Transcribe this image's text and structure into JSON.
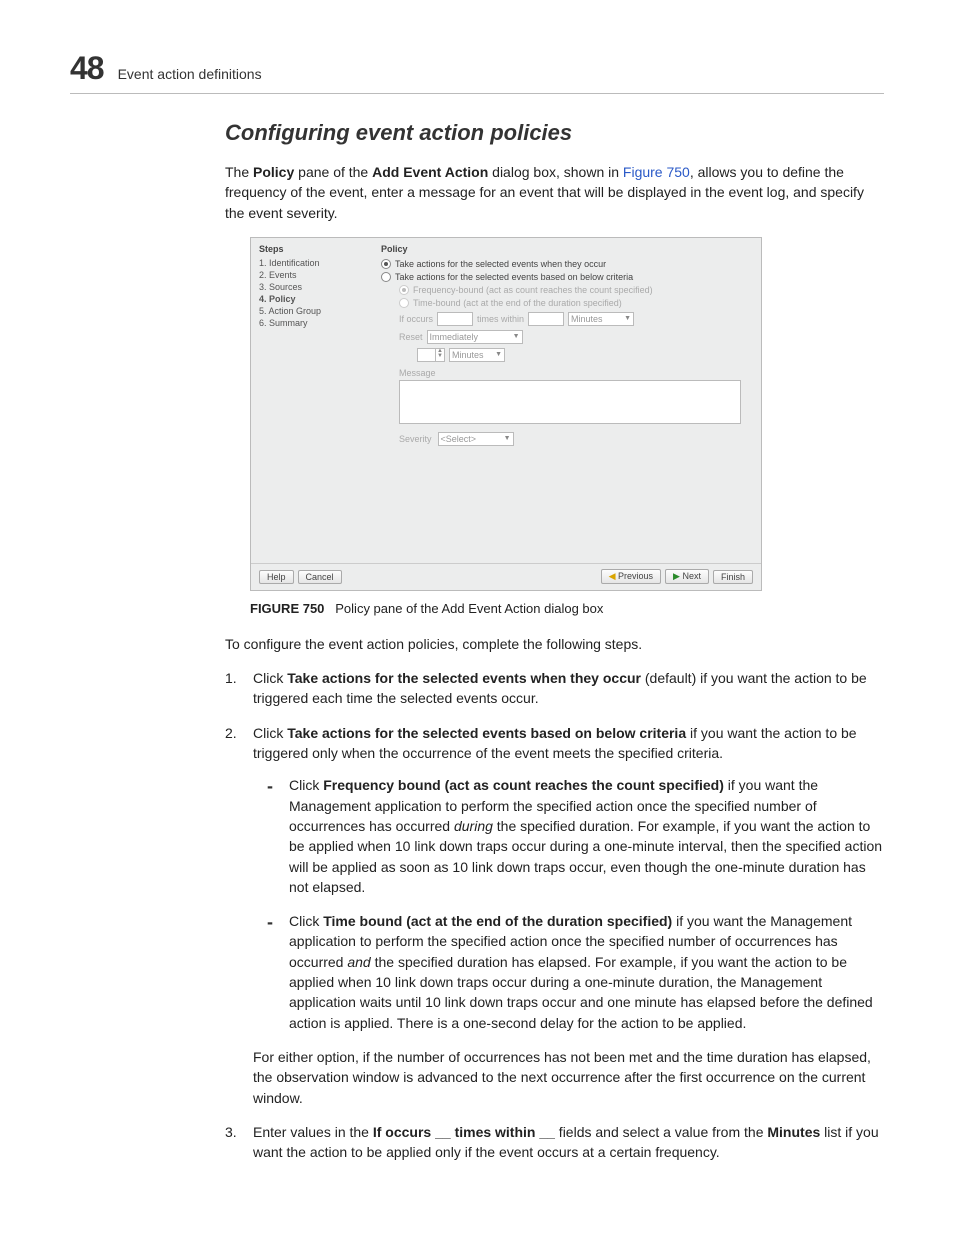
{
  "page_number": "48",
  "page_header": "Event action definitions",
  "section_heading": "Configuring event action policies",
  "intro": {
    "pre": "The ",
    "b1": "Policy",
    "mid1": " pane of the ",
    "b2": "Add Event Action",
    "mid2": " dialog box, shown in ",
    "link": "Figure 750",
    "post": ", allows you to define the frequency of the event, enter a message for an event that will be displayed in the event log, and specify the event severity."
  },
  "shot": {
    "steps_title": "Steps",
    "steps": [
      "1. Identification",
      "2. Events",
      "3. Sources",
      "4. Policy",
      "5. Action Group",
      "6. Summary"
    ],
    "policy_title": "Policy",
    "opt1": "Take actions for the selected events when they occur",
    "opt2": "Take actions for the selected events based on below criteria",
    "sub1": "Frequency-bound (act as count reaches the count specified)",
    "sub2": "Time-bound (act at the end of the duration specified)",
    "if_occurs": "If occurs",
    "times_within": "times within",
    "minutes": "Minutes",
    "reset": "Reset",
    "immediately": "Immediately",
    "message": "Message",
    "severity": "Severity",
    "select_ph": "<Select>",
    "btn_help": "Help",
    "btn_cancel": "Cancel",
    "btn_prev": "Previous",
    "btn_next": "Next",
    "btn_finish": "Finish"
  },
  "figure": {
    "label": "FIGURE 750",
    "caption": "Policy pane of the Add Event Action dialog box"
  },
  "lead_in": "To configure the event action policies, complete the following steps.",
  "step1": {
    "pre": "Click ",
    "b": "Take actions for the selected events when they occur",
    "post": " (default) if you want the action to be triggered each time the selected events occur."
  },
  "step2": {
    "pre": "Click ",
    "b": "Take actions for the selected events based on below criteria",
    "post": " if you want the action to be triggered only when the occurrence of the event meets the specified criteria.",
    "sub1": {
      "pre": "Click ",
      "b": "Frequency bound (act as count reaches the count specified)",
      "mid1": " if you want the Management application to perform the specified action once the specified number of occurrences has occurred ",
      "i": "during",
      "post": " the specified duration. For example, if you want the action to be applied when 10 link down traps occur during a one-minute interval, then the specified action will be applied as soon as 10 link down traps occur, even though the one-minute duration has not elapsed."
    },
    "sub2": {
      "pre": "Click ",
      "b": "Time bound (act at the end of the duration specified)",
      "mid1": " if you want the Management application to perform the specified action once the specified number of occurrences has occurred ",
      "i": "and",
      "post": " the specified duration has elapsed. For example, if you want the action to be applied when 10 link down traps occur during a one-minute duration, the Management application waits until 10 link down traps occur and one minute has elapsed before the defined action is applied. There is a one-second delay for the action to be applied."
    },
    "note": "For either option, if the number of occurrences has not been met and the time duration has elapsed, the observation window is advanced to the next occurrence after the first occurrence on the current window."
  },
  "step3": {
    "pre": "Enter values in the ",
    "b1": "If occurs __ times within __",
    "mid": " fields and select a value from the ",
    "b2": "Minutes",
    "post": " list if you want the action to be applied only if the event occurs at a certain frequency."
  }
}
